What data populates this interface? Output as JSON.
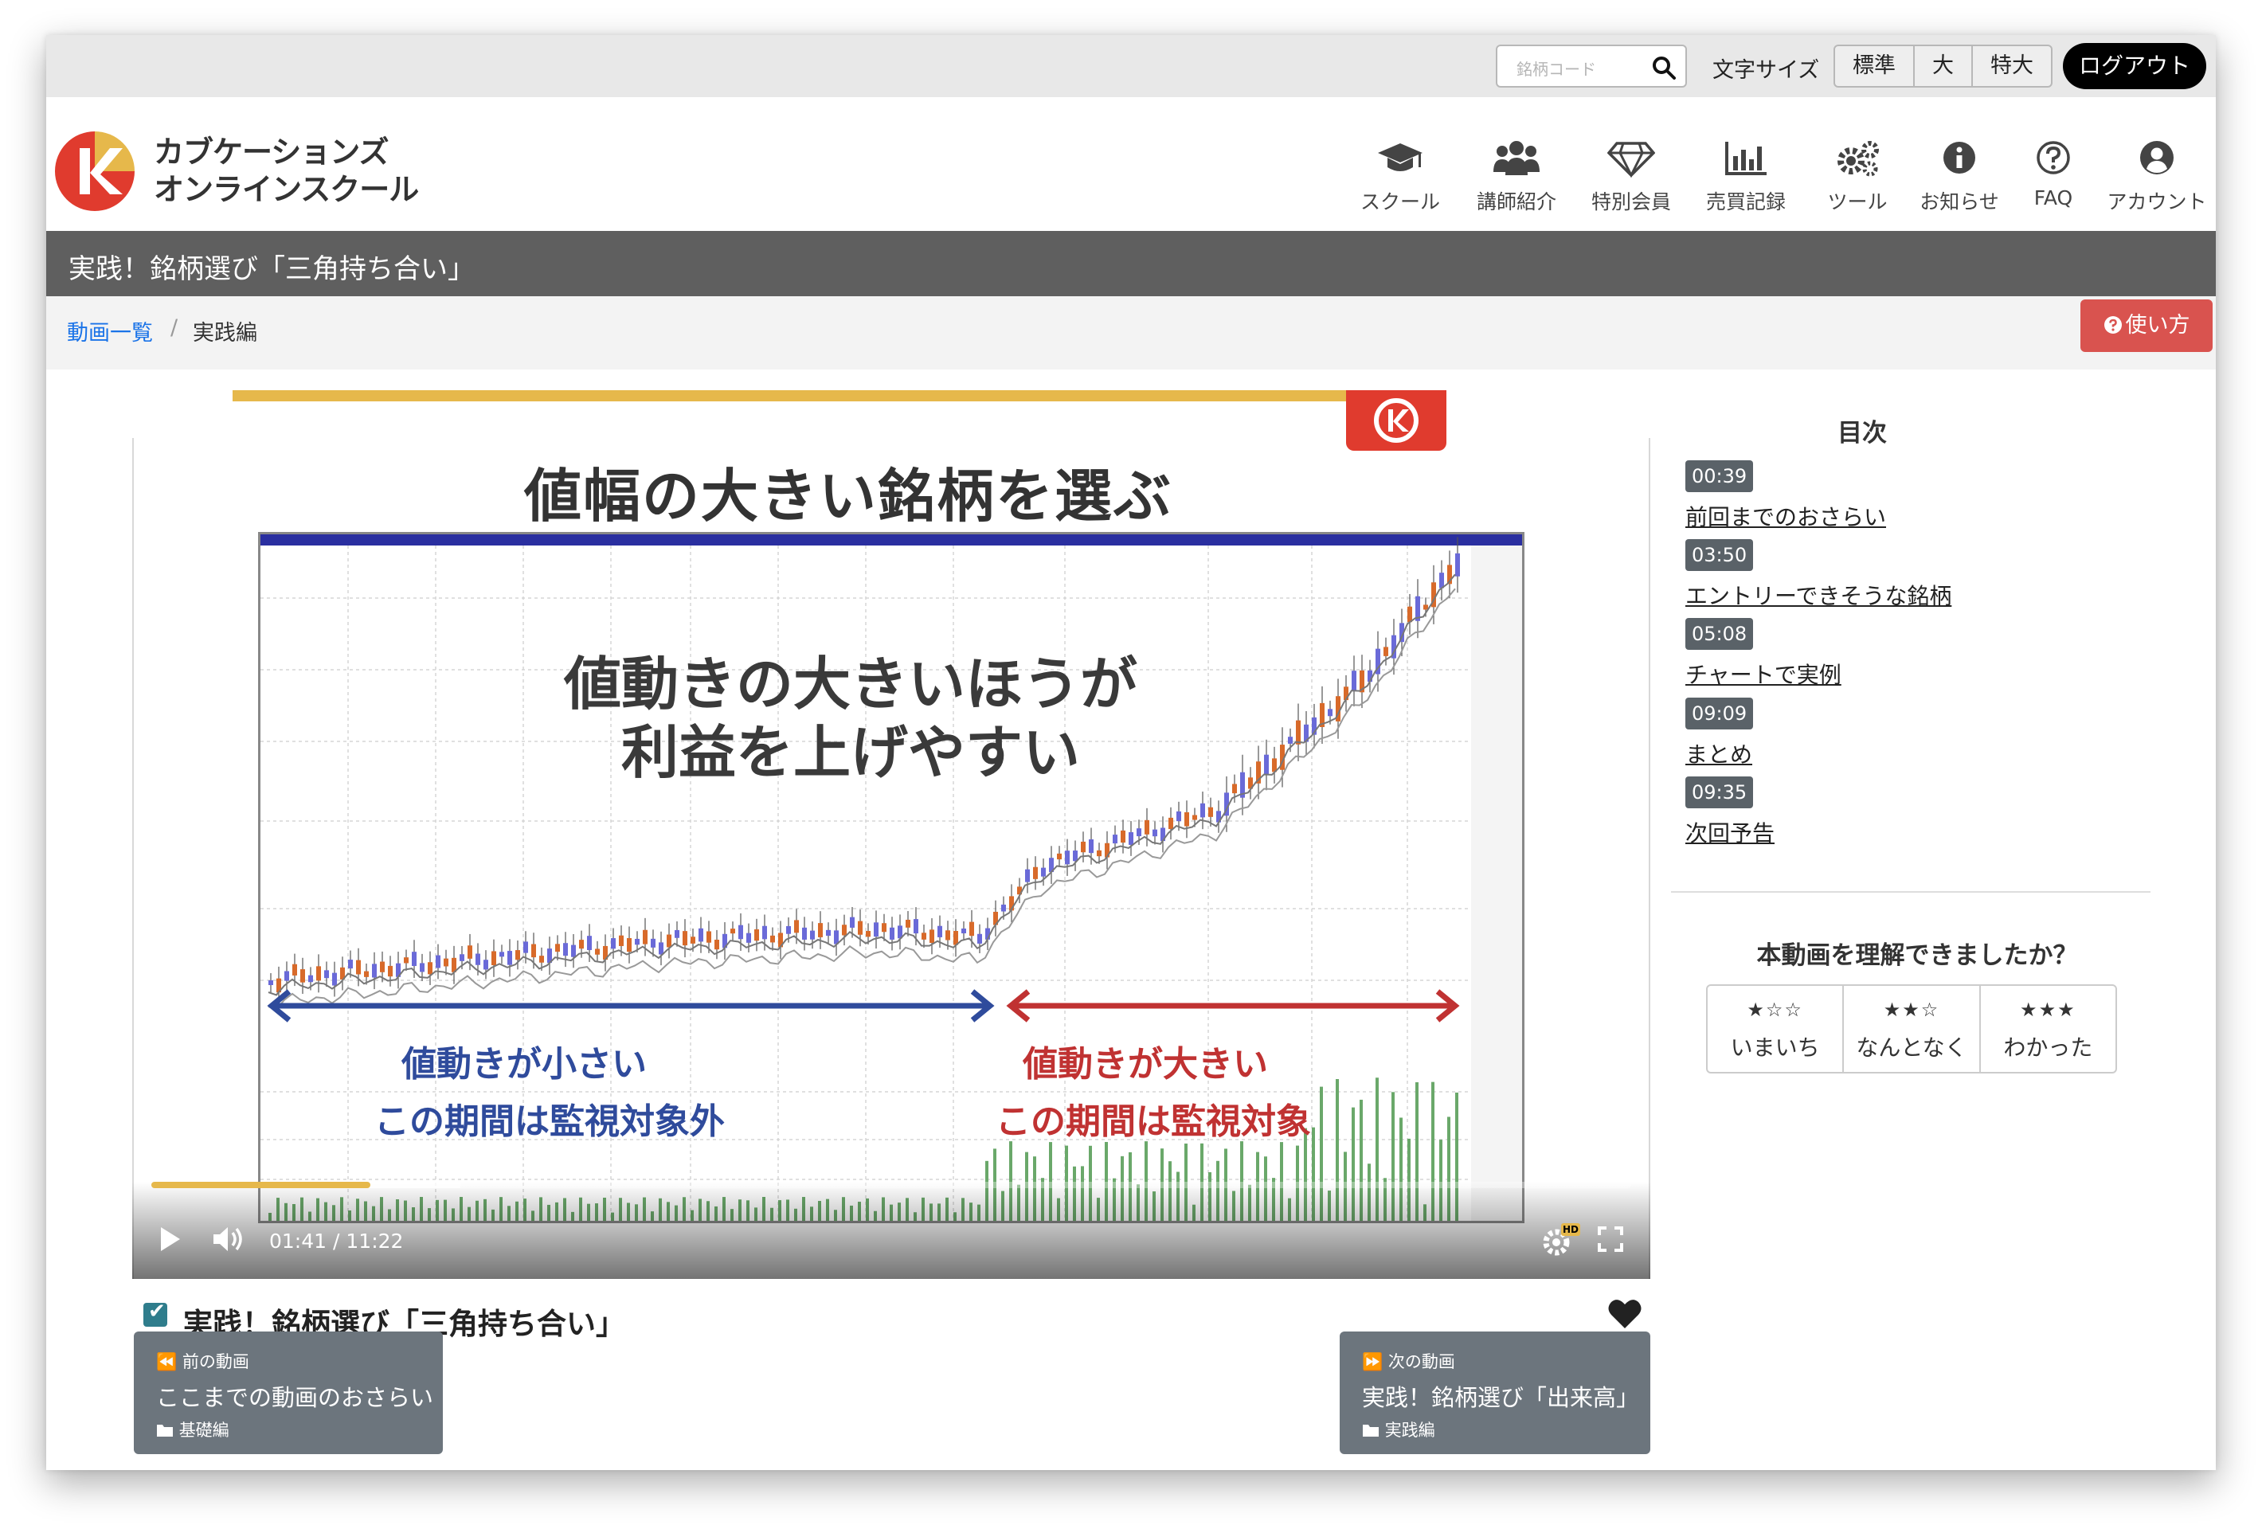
{
  "topbar": {
    "search_placeholder": "銘柄コード",
    "font_size_label": "文字サイズ",
    "font_sizes": [
      "標準",
      "大",
      "特大"
    ],
    "logout": "ログアウト"
  },
  "brand": {
    "line1": "カブケーションズ",
    "line2": "オンラインスクール"
  },
  "nav": [
    {
      "label": "スクール",
      "icon": "graduation-cap-icon"
    },
    {
      "label": "講師紹介",
      "icon": "users-icon"
    },
    {
      "label": "特別会員",
      "icon": "diamond-icon"
    },
    {
      "label": "売買記録",
      "icon": "bar-chart-icon"
    },
    {
      "label": "ツール",
      "icon": "gears-icon"
    },
    {
      "label": "お知らせ",
      "icon": "info-icon"
    },
    {
      "label": "FAQ",
      "icon": "question-icon"
    },
    {
      "label": "アカウント",
      "icon": "user-circle-icon"
    }
  ],
  "page_title": "実践！銘柄選び「三角持ち合い」",
  "breadcrumb": {
    "link": "動画一覧",
    "separator": "/",
    "current": "実践編"
  },
  "howto_button": "使い方",
  "video": {
    "slide_title": "値幅の大きい銘柄を選ぶ",
    "overlay_line1": "値動きの大きいほうが",
    "overlay_line2": "利益を上げやすい",
    "label_small_1": "値動きが小さい",
    "label_small_2": "この期間は監視対象外",
    "label_big_1": "値動きが大きい",
    "label_big_2": "この期間は監視対象",
    "current_time": "01:41",
    "time_separator": "/",
    "duration": "11:22",
    "hd_badge": "HD",
    "progress_fraction": 0.148,
    "accent_color": "#e6b84b"
  },
  "video_title": "実践！銘柄選び「三角持ち合い」",
  "prev_video": {
    "label": "前の動画",
    "title": "ここまでの動画のおさらい",
    "category": "基礎編"
  },
  "next_video": {
    "label": "次の動画",
    "title": "実践！銘柄選び「出来高」",
    "category": "実践編"
  },
  "toc": {
    "heading": "目次",
    "items": [
      {
        "time": "00:39",
        "title": "前回までのおさらい"
      },
      {
        "time": "03:50",
        "title": "エントリーできそうな銘柄"
      },
      {
        "time": "05:08",
        "title": "チャートで実例"
      },
      {
        "time": "09:09",
        "title": "まとめ"
      },
      {
        "time": "09:35",
        "title": "次回予告"
      }
    ]
  },
  "rating": {
    "question": "本動画を理解できましたか？",
    "options": [
      {
        "stars": "★☆☆",
        "label": "いまいち"
      },
      {
        "stars": "★★☆",
        "label": "なんとなく"
      },
      {
        "stars": "★★★",
        "label": "わかった"
      }
    ]
  },
  "colors": {
    "howto": "#d9534f",
    "title_bar": "#5f5f5f",
    "link": "#1a73e8",
    "brand_red": "#e03b2e",
    "brand_gold": "#e6b84b"
  }
}
